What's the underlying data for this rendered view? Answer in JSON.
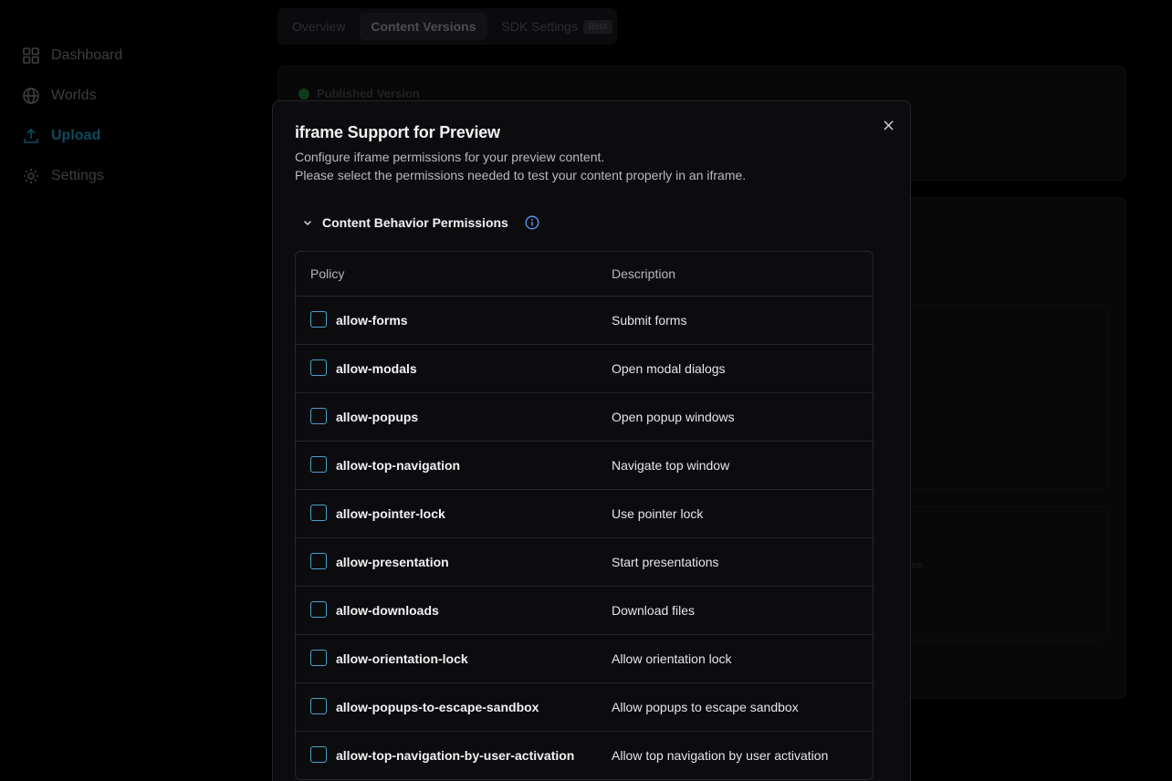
{
  "sidebar": {
    "items": [
      {
        "label": "Dashboard",
        "icon": "dashboard-icon"
      },
      {
        "label": "Worlds",
        "icon": "globe-icon"
      },
      {
        "label": "Upload",
        "icon": "upload-icon",
        "active": true
      },
      {
        "label": "Settings",
        "icon": "gear-icon"
      }
    ]
  },
  "tabs": {
    "overview": "Overview",
    "content_versions": "Content Versions",
    "sdk_settings": "SDK Settings",
    "beta": "Beta"
  },
  "background": {
    "published_version": "Published Version",
    "faint_text": "me."
  },
  "modal": {
    "title": "iframe Support for Preview",
    "description_line1": "Configure iframe permissions for your preview content.",
    "description_line2": "Please select the permissions needed to test your content properly in an iframe.",
    "section_title": "Content Behavior Permissions",
    "table": {
      "col_policy": "Policy",
      "col_description": "Description",
      "rows": [
        {
          "policy": "allow-forms",
          "description": "Submit forms"
        },
        {
          "policy": "allow-modals",
          "description": "Open modal dialogs"
        },
        {
          "policy": "allow-popups",
          "description": "Open popup windows"
        },
        {
          "policy": "allow-top-navigation",
          "description": "Navigate top window"
        },
        {
          "policy": "allow-pointer-lock",
          "description": "Use pointer lock"
        },
        {
          "policy": "allow-presentation",
          "description": "Start presentations"
        },
        {
          "policy": "allow-downloads",
          "description": "Download files"
        },
        {
          "policy": "allow-orientation-lock",
          "description": "Allow orientation lock"
        },
        {
          "policy": "allow-popups-to-escape-sandbox",
          "description": "Allow popups to escape sandbox"
        },
        {
          "policy": "allow-top-navigation-by-user-activation",
          "description": "Allow top navigation by user activation"
        }
      ]
    }
  },
  "colors": {
    "accent": "#4aa3c7",
    "info": "#5b9cf5"
  }
}
